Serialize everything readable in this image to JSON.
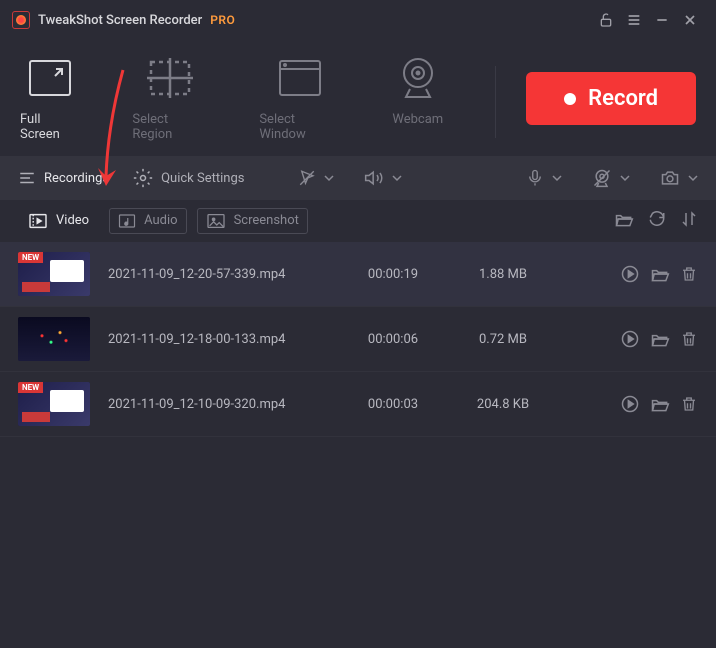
{
  "app": {
    "title": "TweakShot Screen Recorder",
    "badge": "PRO"
  },
  "modes": [
    {
      "label": "Full Screen",
      "icon": "fullscreen",
      "active": true
    },
    {
      "label": "Select Region",
      "icon": "region",
      "active": false
    },
    {
      "label": "Select Window",
      "icon": "window",
      "active": false
    },
    {
      "label": "Webcam",
      "icon": "webcam",
      "active": false
    }
  ],
  "record_button": "Record",
  "settings": {
    "recordings_label": "Recordings",
    "quick_settings_label": "Quick Settings"
  },
  "tabs": [
    {
      "label": "Video",
      "icon": "video",
      "active": true
    },
    {
      "label": "Audio",
      "icon": "audio",
      "active": false
    },
    {
      "label": "Screenshot",
      "icon": "screenshot",
      "active": false
    }
  ],
  "files": [
    {
      "name": "2021-11-09_12-20-57-339.mp4",
      "duration": "00:00:19",
      "size": "1.88 MB",
      "is_new": true,
      "thumb": 1,
      "active": true
    },
    {
      "name": "2021-11-09_12-18-00-133.mp4",
      "duration": "00:00:06",
      "size": "0.72 MB",
      "is_new": false,
      "thumb": 2,
      "active": false
    },
    {
      "name": "2021-11-09_12-10-09-320.mp4",
      "duration": "00:00:03",
      "size": "204.8 KB",
      "is_new": true,
      "thumb": 1,
      "active": false
    }
  ],
  "new_badge": "NEW"
}
